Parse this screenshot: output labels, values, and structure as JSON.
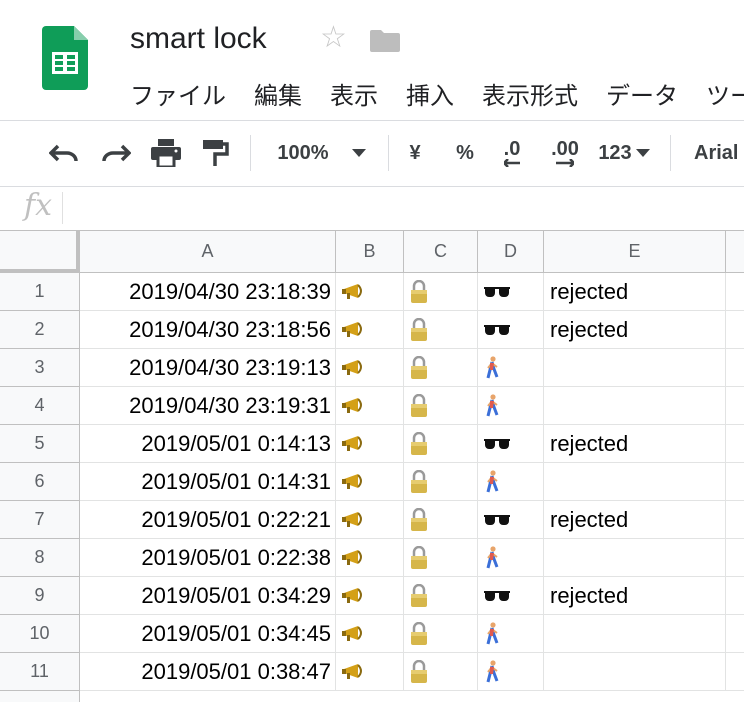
{
  "document": {
    "title": "smart lock",
    "app_icon": "google-sheets-icon",
    "star_icon": "star-outline-icon",
    "folder_icon": "folder-icon",
    "brand_color": "#0f9d58"
  },
  "menu": [
    "ファイル",
    "編集",
    "表示",
    "挿入",
    "表示形式",
    "データ",
    "ツー"
  ],
  "toolbar": {
    "undo_icon": "undo-icon",
    "redo_icon": "redo-icon",
    "print_icon": "print-icon",
    "paint_format_icon": "paint-format-icon",
    "zoom": "100%",
    "currency": "¥",
    "percent": "%",
    "decrease_decimal": ".0",
    "increase_decimal": ".00",
    "more_formats": "123",
    "font": "Arial"
  },
  "formula_bar": {
    "label": "fx",
    "value": ""
  },
  "columns": [
    "A",
    "B",
    "C",
    "D",
    "E"
  ],
  "rows": [
    {
      "num": "1",
      "timestamp": "2019/04/30 23:18:39",
      "b": "megaphone",
      "c": "lock",
      "d": "sunglasses",
      "e": "rejected"
    },
    {
      "num": "2",
      "timestamp": "2019/04/30 23:18:56",
      "b": "megaphone",
      "c": "lock",
      "d": "sunglasses",
      "e": "rejected"
    },
    {
      "num": "3",
      "timestamp": "2019/04/30 23:19:13",
      "b": "megaphone",
      "c": "lock",
      "d": "walking-person",
      "e": ""
    },
    {
      "num": "4",
      "timestamp": "2019/04/30 23:19:31",
      "b": "megaphone",
      "c": "lock",
      "d": "walking-person",
      "e": ""
    },
    {
      "num": "5",
      "timestamp": "2019/05/01 0:14:13",
      "b": "megaphone",
      "c": "lock",
      "d": "sunglasses",
      "e": "rejected"
    },
    {
      "num": "6",
      "timestamp": "2019/05/01 0:14:31",
      "b": "megaphone",
      "c": "lock",
      "d": "walking-person",
      "e": ""
    },
    {
      "num": "7",
      "timestamp": "2019/05/01 0:22:21",
      "b": "megaphone",
      "c": "lock",
      "d": "sunglasses",
      "e": "rejected"
    },
    {
      "num": "8",
      "timestamp": "2019/05/01 0:22:38",
      "b": "megaphone",
      "c": "lock",
      "d": "walking-person",
      "e": ""
    },
    {
      "num": "9",
      "timestamp": "2019/05/01 0:34:29",
      "b": "megaphone",
      "c": "lock",
      "d": "sunglasses",
      "e": "rejected"
    },
    {
      "num": "10",
      "timestamp": "2019/05/01 0:34:45",
      "b": "megaphone",
      "c": "lock",
      "d": "walking-person",
      "e": ""
    },
    {
      "num": "11",
      "timestamp": "2019/05/01 0:38:47",
      "b": "megaphone",
      "c": "lock",
      "d": "walking-person",
      "e": ""
    }
  ]
}
